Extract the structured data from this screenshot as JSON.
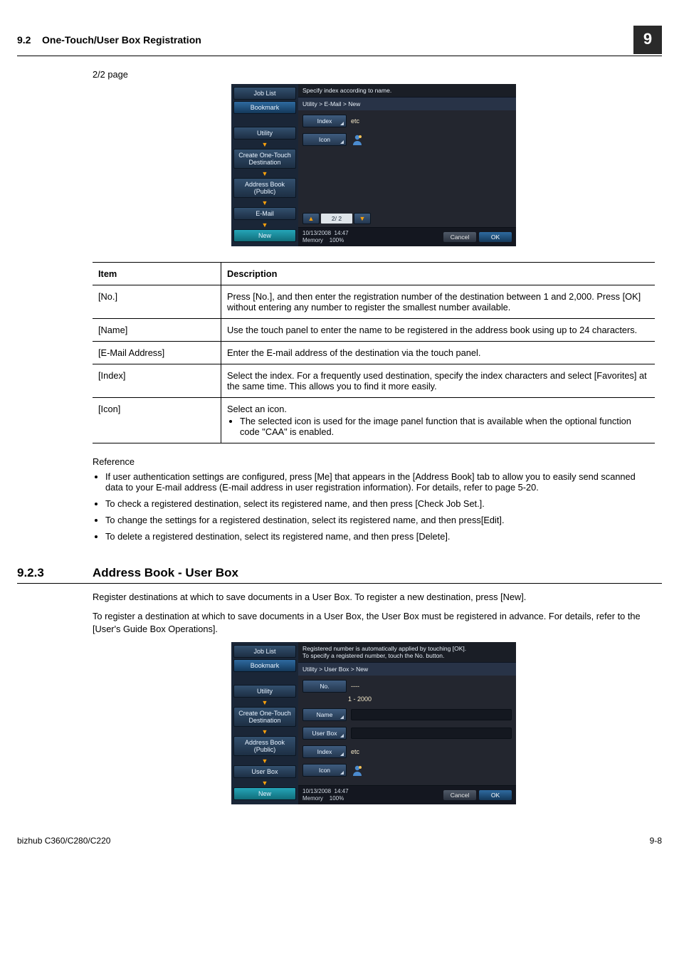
{
  "header": {
    "sec": "9.2",
    "title": "One-Touch/User Box Registration",
    "chapter": "9"
  },
  "page_indicator": "2/2 page",
  "screenshot1": {
    "side": {
      "joblist": "Job List",
      "bookmark": "Bookmark",
      "utility": "Utility",
      "create": "Create One-Touch\nDestination",
      "addrbook": "Address Book\n(Public)",
      "email": "E-Mail",
      "new": "New"
    },
    "top": "Specify index according to name.",
    "crumb": "Utility > E-Mail > New",
    "rows": {
      "index_label": "Index",
      "index_val": "etc",
      "icon_label": "Icon"
    },
    "pager": {
      "page": "2/ 2"
    },
    "status": {
      "date": "10/13/2008",
      "time": "14:47",
      "mem": "Memory",
      "pct": "100%"
    },
    "cancel": "Cancel",
    "ok": "OK"
  },
  "table": {
    "h1": "Item",
    "h2": "Description",
    "rows": [
      {
        "item": "[No.]",
        "desc": "Press [No.], and then enter the registration number of the destination between 1 and 2,000. Press [OK] without entering any number to register the smallest number available."
      },
      {
        "item": "[Name]",
        "desc": "Use the touch panel to enter the name to be registered in the address book using up to 24 characters."
      },
      {
        "item": "[E-Mail Address]",
        "desc": "Enter the E-mail address of the destination via the touch panel."
      },
      {
        "item": "[Index]",
        "desc": "Select the index. For a frequently used destination, specify the index characters and select [Favorites] at the same time. This allows you to find it more easily."
      },
      {
        "item": "[Icon]",
        "desc": "Select an icon.",
        "bullet": "The selected icon is used for the image panel function that is available when the optional function code \"CAA\" is enabled."
      }
    ]
  },
  "ref": {
    "heading": "Reference",
    "items": [
      "If user authentication settings are configured, press [Me] that appears in the [Address Book] tab to allow you to easily send scanned data to your E-mail address (E-mail address in user registration information). For details, refer to page 5-20.",
      "To check a registered destination, select its registered name, and then press [Check Job Set.].",
      "To change the settings for a registered destination, select its registered name, and then press[Edit].",
      "To delete a registered destination, select its registered name, and then press [Delete]."
    ]
  },
  "section923": {
    "num": "9.2.3",
    "title": "Address Book - User Box",
    "p1": "Register destinations at which to save documents in a User Box. To register a new destination, press [New].",
    "p2": "To register a destination at which to save documents in a User Box, the User Box must be registered in advance. For details, refer to the [User's Guide Box Operations]."
  },
  "screenshot2": {
    "side": {
      "joblist": "Job List",
      "bookmark": "Bookmark",
      "utility": "Utility",
      "create": "Create One-Touch\nDestination",
      "addrbook": "Address Book\n(Public)",
      "userbox": "User Box",
      "new": "New"
    },
    "top": "Registered number is automatically applied by touching [OK].\nTo specify a registered number, touch the No. button.",
    "crumb": "Utility > User Box > New",
    "rows": {
      "no_label": "No.",
      "no_val": "----",
      "no_range": "1  -  2000",
      "name_label": "Name",
      "ub_label": "User Box",
      "index_label": "Index",
      "index_val": "etc",
      "icon_label": "Icon"
    },
    "status": {
      "date": "10/13/2008",
      "time": "14:47",
      "mem": "Memory",
      "pct": "100%"
    },
    "cancel": "Cancel",
    "ok": "OK"
  },
  "footer": {
    "model": "bizhub C360/C280/C220",
    "pg": "9-8"
  }
}
